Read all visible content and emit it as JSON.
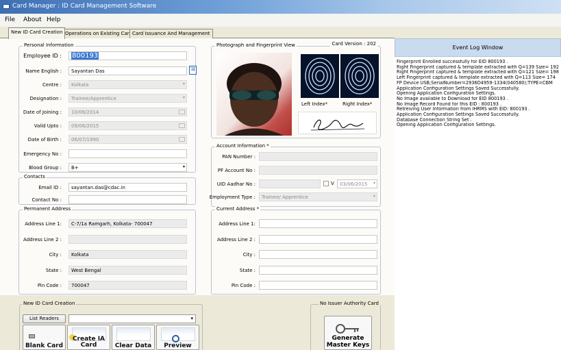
{
  "window": {
    "title": "Card Manager : ID Card Management Software"
  },
  "menu": [
    "File",
    "About",
    "Help"
  ],
  "tabs": [
    "New ID Card Creation",
    "Operations on Existing Card",
    "Card Issuance And Management"
  ],
  "personal": {
    "title": "Personal Information",
    "employee_id_label": "Employee ID :",
    "employee_id": "800193",
    "name_label": "Name English :",
    "name": "Sayantan Das",
    "centre_label": "Centre :",
    "centre": "Kolkata",
    "designation_label": "Designation :",
    "designation": "Trainee/Apprentice",
    "doj_label": "Date of Joining :",
    "doj": "10/06/2014",
    "valid_label": "Valid Upto :",
    "valid": "09/06/2015",
    "dob_label": "Date of Birth :",
    "dob": "06/07/1990",
    "emergency_label": "Emergency No :",
    "emergency": "",
    "blood_label": "Blood Group :",
    "blood": "B+"
  },
  "photo": {
    "title": "Photograph and Fingerprint View",
    "card_version": "Card Version : 202",
    "left_index": "Left Index*",
    "right_index": "Right Index*"
  },
  "contacts": {
    "title": "Contacts",
    "email_label": "Email ID :",
    "email": "sayantan.das@cdac.in",
    "contact_label": "Contact No :",
    "contact": ""
  },
  "account": {
    "title": "Account Information *",
    "pan_label": "PAN Number :",
    "pf_label": "PF Account No :",
    "uid_label": "UID Aadhar No :",
    "uid_check": "V",
    "uid_date": "03/06/2015",
    "emp_type_label": "Employment Type :",
    "emp_type": "Trainee/ Apprentice"
  },
  "permanent": {
    "title": "Permanent Address",
    "line1_label": "Address Line 1:",
    "line1": "C-7/1a Ramgarh, Kolkata- 700047",
    "line2_label": "Address Line 2 :",
    "line2": "",
    "city_label": "City :",
    "city": "Kolkata",
    "state_label": "State :",
    "state": "West Bengal",
    "pin_label": "Pin Code :",
    "pin": "700047"
  },
  "current": {
    "title": "Current Address *",
    "line1_label": "Address Line 1:",
    "line2_label": "Address Line 2 :",
    "city_label": "City :",
    "state_label": "State :",
    "pin_label": "Pin Code :"
  },
  "creation": {
    "title": "New ID Card  Creation",
    "list_readers": "List Readers",
    "tiles": [
      "Blank Card",
      "Create IA Card",
      "Clear Data",
      "Preview"
    ],
    "no_issuer": "No Issuer Authority Card",
    "generate": "Generate Master Keys"
  },
  "log": {
    "title": "Event Log Window",
    "lines": [
      "Fingerprint Enrolled successfully for EID 800193 .",
      "Right Fingerprint captured & template extracted with Q=139 Size= 192",
      "Right Fingerprint captured & template extracted with Q=121 Size= 198",
      "Left Fingerprint captured & template extracted with Q=113 Size= 174",
      "FP Device USB;SerialNumber=2936D4959-1334(040580);TYPE=CBM",
      "Application Configuration Settings Saved Successfully.",
      "Opening Application Configuration Settings.",
      "No Image available to Download for EID 800193 .",
      "No Image Record Found for this EID : 800193 .",
      "Retreiving User Information from IHRMS with EID: 800193 .",
      "Application Configuration Settings Saved Successfully.",
      "Database Connection String Set .",
      "Opening Application Configuration Settings."
    ]
  }
}
